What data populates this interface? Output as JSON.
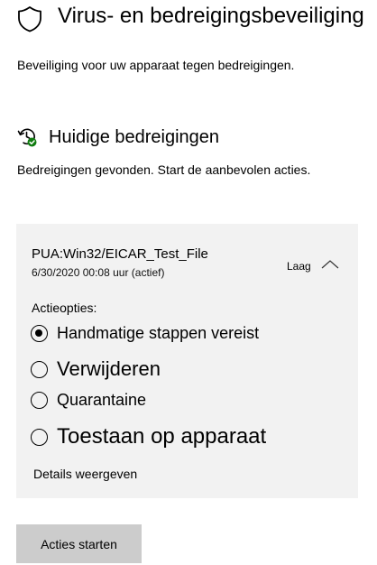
{
  "header": {
    "title": "Virus- en bedreigingsbeveiliging",
    "subtitle": "Beveiliging voor uw apparaat tegen bedreigingen.",
    "icon": "shield-icon"
  },
  "current_threats": {
    "title": "Huidige bedreigingen",
    "subtitle": "Bedreigingen gevonden. Start de aanbevolen acties.",
    "icon": "threat-history-icon",
    "accent_color": "#107c10"
  },
  "threat": {
    "name": "PUA:Win32/EICAR_Test_File",
    "date": "6/30/2020",
    "time": "00:08 uur (actief)",
    "severity": "Laag",
    "expanded": true,
    "actions_label": "Actieopties:",
    "options": [
      {
        "label": "Handmatige stappen vereist",
        "selected": true
      },
      {
        "label": "Verwijderen",
        "selected": false
      },
      {
        "label": "Quarantaine",
        "selected": false
      },
      {
        "label": "Toestaan op apparaat",
        "selected": false
      }
    ],
    "details_label": "Details weergeven"
  },
  "footer": {
    "start_button_label": "Acties starten"
  }
}
